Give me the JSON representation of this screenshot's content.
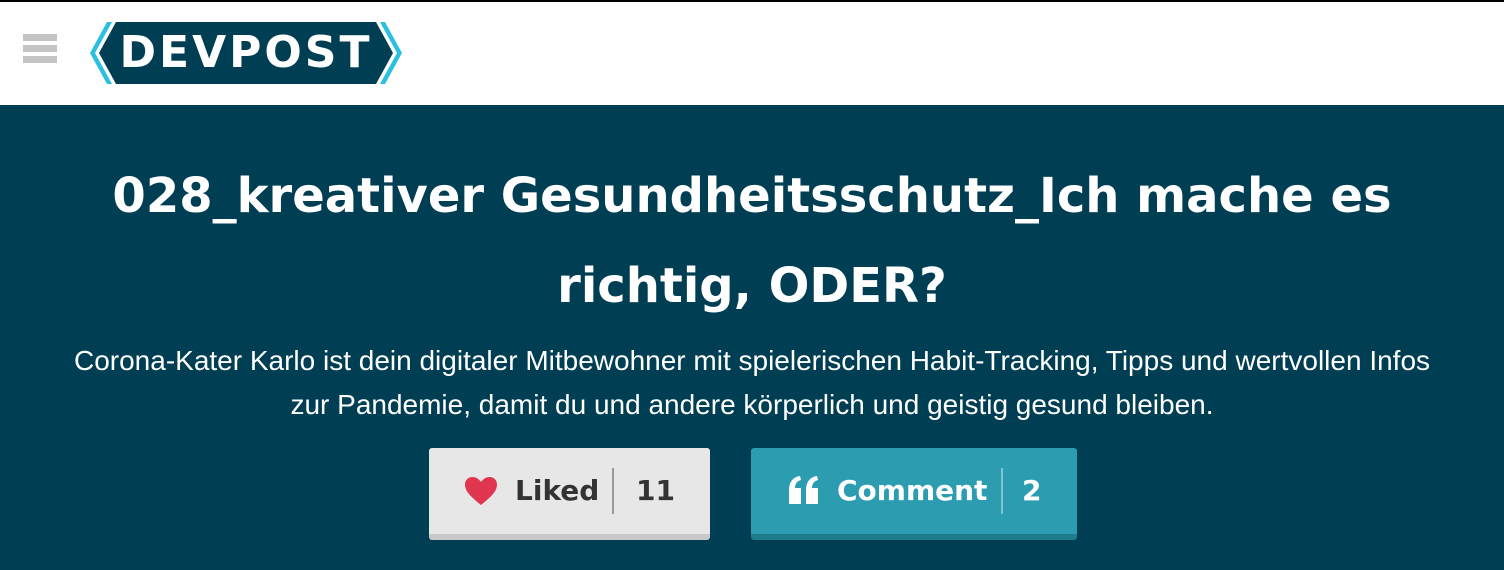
{
  "header": {
    "logo_text": "DEVPOST",
    "menu_icon": "hamburger-menu-icon",
    "logo_color": "#003e54",
    "logo_accent": "#2bbfe0"
  },
  "project": {
    "title": "028_kreativer Gesundheitsschutz_Ich mache es richtig, ODER?",
    "tagline": "Corona-Kater Karlo ist dein digitaler Mitbewohner mit spielerischen Habit-Tracking, Tipps und wertvollen Infos zur Pandemie, damit du und andere körperlich und geistig gesund bleiben."
  },
  "actions": {
    "like": {
      "label": "Liked",
      "count": "11",
      "icon": "heart-icon",
      "color": "#e7e7e7",
      "icon_color": "#e0364f"
    },
    "comment": {
      "label": "Comment",
      "count": "2",
      "icon": "quote-icon",
      "color": "#2c9db1"
    }
  },
  "colors": {
    "hero_bg": "#003e54",
    "topbar_bg": "#ffffff"
  }
}
